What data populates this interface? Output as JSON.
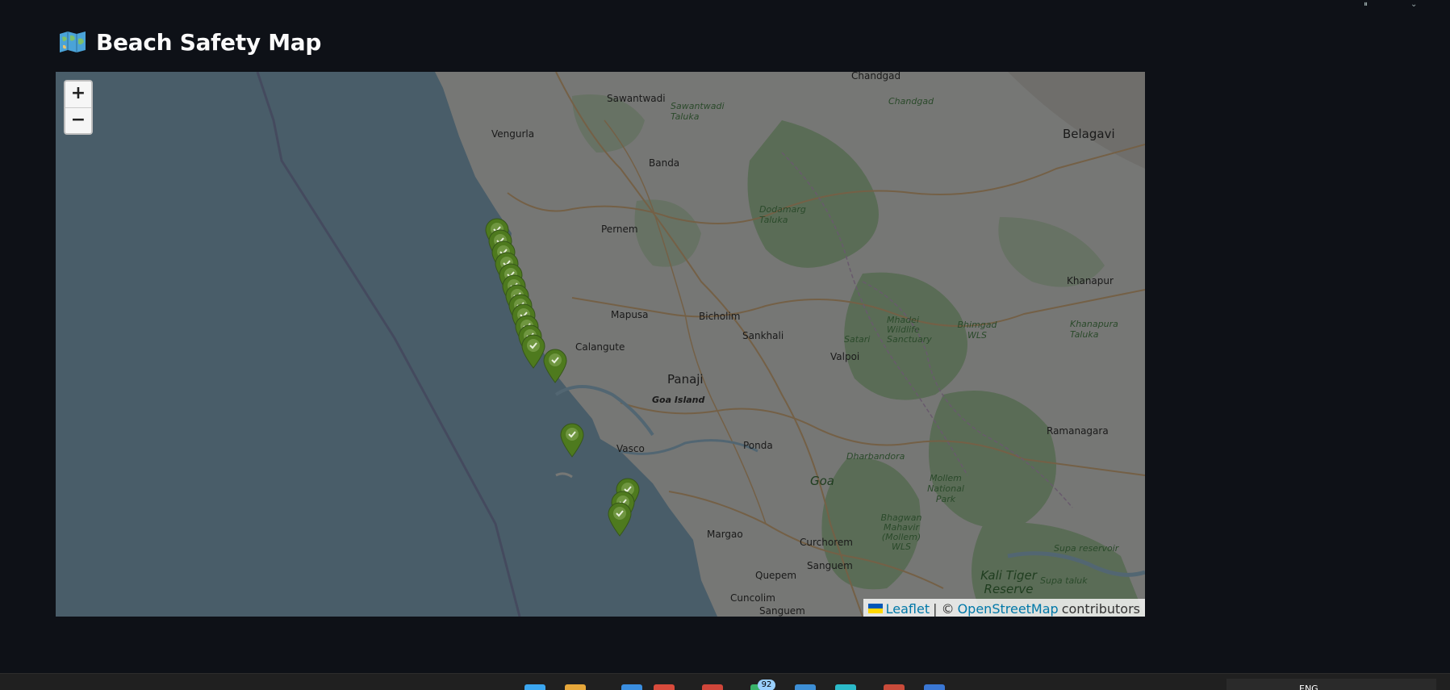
{
  "page": {
    "title": "Beach Safety Map"
  },
  "map": {
    "zoom_in_label": "+",
    "zoom_out_label": "−",
    "attribution": {
      "leaflet": "Leaflet",
      "separator": "| ©",
      "osm": "OpenStreetMap",
      "suffix": "contributors"
    },
    "labels": {
      "chandgad_top": "Chandgad",
      "chandgad_it": "Chandgad",
      "sawantwadi": "Sawantwadi",
      "sawantwadi_taluka": "Sawantwadi Taluka",
      "vengurla": "Vengurla",
      "belagavi": "Belagavi",
      "banda": "Banda",
      "pernem": "Pernem",
      "dodamarg": "Dodamarg Taluka",
      "khanapur": "Khanapur",
      "mapusa": "Mapusa",
      "bicholim": "Bicholim",
      "sankhali": "Sankhali",
      "mhadei": "Mhadei Wildlife Sanctuary",
      "bhimgad": "Bhimgad WLS",
      "khanapura_taluka": "Khanapura Taluka",
      "satari": "Satari",
      "valpoi": "Valpoi",
      "calangute": "Calangute",
      "panaji": "Panaji",
      "goa_island": "Goa Island",
      "ramanagara": "Ramanagara",
      "vasco": "Vasco",
      "ponda": "Ponda",
      "dharbandora": "Dharbandora",
      "goa": "Goa",
      "mollem": "Mollem National Park",
      "margao": "Margao",
      "bhagwan": "Bhagwan Mahavir (Mollem) WLS",
      "curchorem": "Curchorem",
      "sanguem": "Sanguem",
      "supa_reservoir": "Supa reservoir",
      "quepem": "Quepem",
      "kali_tiger": "Kali Tiger Reserve",
      "supa_taluk": "Supa taluk",
      "cuncolim": "Cuncolim",
      "sanguem_bottom": "Sanguem"
    },
    "markers": [
      {
        "id": "beach-1",
        "status": "safe"
      },
      {
        "id": "beach-2",
        "status": "safe"
      },
      {
        "id": "beach-3",
        "status": "safe"
      },
      {
        "id": "beach-4",
        "status": "safe"
      },
      {
        "id": "beach-5",
        "status": "safe"
      },
      {
        "id": "beach-6",
        "status": "safe"
      },
      {
        "id": "beach-7",
        "status": "safe"
      },
      {
        "id": "beach-8",
        "status": "safe"
      },
      {
        "id": "beach-9",
        "status": "safe"
      },
      {
        "id": "beach-10",
        "status": "safe"
      },
      {
        "id": "beach-11",
        "status": "safe"
      },
      {
        "id": "beach-12",
        "status": "safe"
      },
      {
        "id": "beach-13",
        "status": "safe"
      },
      {
        "id": "beach-14",
        "status": "safe"
      },
      {
        "id": "beach-15",
        "status": "safe"
      },
      {
        "id": "beach-16",
        "status": "safe"
      },
      {
        "id": "beach-17",
        "status": "safe"
      }
    ],
    "colors": {
      "marker": "#4e7a1e",
      "sea": "#8ab0c2",
      "land": "#e9e5dc",
      "forest": "#aecf9b"
    }
  },
  "taskbar": {
    "badge_count": "92",
    "language": "ENG"
  }
}
